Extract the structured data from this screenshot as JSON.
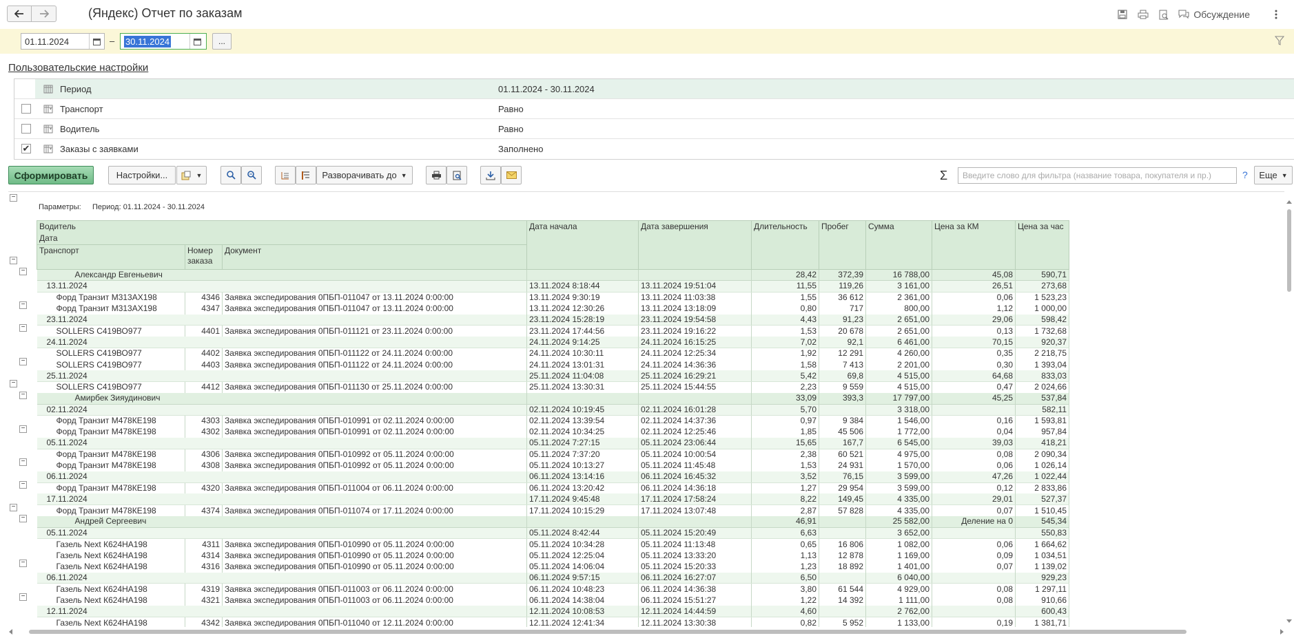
{
  "window": {
    "title": "(Яндекс) Отчет по заказам",
    "discuss_label": "Обсуждение"
  },
  "period": {
    "from": "01.11.2024",
    "to": "30.11.2024",
    "dash": "–",
    "more": "..."
  },
  "user_settings": {
    "link": "Пользовательские настройки",
    "rows": [
      {
        "name": "Период",
        "value": "01.11.2024 - 30.11.2024",
        "checked": null
      },
      {
        "name": "Транспорт",
        "value": "Равно",
        "checked": false
      },
      {
        "name": "Водитель",
        "value": "Равно",
        "checked": false
      },
      {
        "name": "Заказы с заявками",
        "value": "Заполнено",
        "checked": true
      }
    ]
  },
  "toolbar": {
    "generate": "Сформировать",
    "settings": "Настройки...",
    "expand_to": "Разворачивать до",
    "search_placeholder": "Введите слово для фильтра (название товара, покупателя и пр.)",
    "help": "?",
    "more": "Еще"
  },
  "report": {
    "params_label": "Параметры:",
    "params_value": "Период: 01.11.2024 - 30.11.2024",
    "headers": {
      "driver": "Водитель",
      "date": "Дата",
      "transport": "Транспорт",
      "order_no": "Номер заказа",
      "document": "Документ",
      "start": "Дата начала",
      "end": "Дата завершения",
      "duration": "Длительность",
      "mileage": "Пробег",
      "sum": "Сумма",
      "price_km": "Цена за КМ",
      "price_hour": "Цена за час"
    },
    "rows": [
      {
        "lvl": 1,
        "label": "Александр Евгеньевич",
        "start": "",
        "end": "",
        "dur": "28,42",
        "km": "372,39",
        "sum": "16 788,00",
        "pkm": "45,08",
        "ph": "590,71"
      },
      {
        "lvl": 2,
        "label": "13.11.2024",
        "start": "13.11.2024 8:18:44",
        "end": "13.11.2024 19:51:04",
        "dur": "11,55",
        "km": "119,26",
        "sum": "3 161,00",
        "pkm": "26,51",
        "ph": "273,68"
      },
      {
        "lvl": 3,
        "label": "Форд Транзит М313АХ198",
        "num": "4346",
        "doc": "Заявка экспедирования 0ПБП-011047 от 13.11.2024 0:00:00",
        "start": "13.11.2024 9:30:19",
        "end": "13.11.2024 11:03:38",
        "dur": "1,55",
        "km": "36 612",
        "sum": "2 361,00",
        "pkm": "0,06",
        "ph": "1 523,23"
      },
      {
        "lvl": 3,
        "label": "Форд Транзит М313АХ198",
        "num": "4347",
        "doc": "Заявка экспедирования 0ПБП-011047 от 13.11.2024 0:00:00",
        "start": "13.11.2024 12:30:26",
        "end": "13.11.2024 13:18:09",
        "dur": "0,80",
        "km": "717",
        "sum": "800,00",
        "pkm": "1,12",
        "ph": "1 000,00"
      },
      {
        "lvl": 2,
        "label": "23.11.2024",
        "start": "23.11.2024 15:28:19",
        "end": "23.11.2024 19:54:58",
        "dur": "4,43",
        "km": "91,23",
        "sum": "2 651,00",
        "pkm": "29,06",
        "ph": "598,42"
      },
      {
        "lvl": 3,
        "label": "SOLLERS С419ВО977",
        "num": "4401",
        "doc": "Заявка экспедирования 0ПБП-011121 от 23.11.2024 0:00:00",
        "start": "23.11.2024 17:44:56",
        "end": "23.11.2024 19:16:22",
        "dur": "1,53",
        "km": "20 678",
        "sum": "2 651,00",
        "pkm": "0,13",
        "ph": "1 732,68"
      },
      {
        "lvl": 2,
        "label": "24.11.2024",
        "start": "24.11.2024 9:14:25",
        "end": "24.11.2024 16:15:25",
        "dur": "7,02",
        "km": "92,1",
        "sum": "6 461,00",
        "pkm": "70,15",
        "ph": "920,37"
      },
      {
        "lvl": 3,
        "label": "SOLLERS С419ВО977",
        "num": "4402",
        "doc": "Заявка экспедирования 0ПБП-011122 от 24.11.2024 0:00:00",
        "start": "24.11.2024 10:30:11",
        "end": "24.11.2024 12:25:34",
        "dur": "1,92",
        "km": "12 291",
        "sum": "4 260,00",
        "pkm": "0,35",
        "ph": "2 218,75"
      },
      {
        "lvl": 3,
        "label": "SOLLERS С419ВО977",
        "num": "4403",
        "doc": "Заявка экспедирования 0ПБП-011122 от 24.11.2024 0:00:00",
        "start": "24.11.2024 13:01:31",
        "end": "24.11.2024 14:36:36",
        "dur": "1,58",
        "km": "7 413",
        "sum": "2 201,00",
        "pkm": "0,30",
        "ph": "1 393,04"
      },
      {
        "lvl": 2,
        "label": "25.11.2024",
        "start": "25.11.2024 11:04:08",
        "end": "25.11.2024 16:29:21",
        "dur": "5,42",
        "km": "69,8",
        "sum": "4 515,00",
        "pkm": "64,68",
        "ph": "833,03"
      },
      {
        "lvl": 3,
        "label": "SOLLERS С419ВО977",
        "num": "4412",
        "doc": "Заявка экспедирования 0ПБП-011130 от 25.11.2024 0:00:00",
        "start": "25.11.2024 13:30:31",
        "end": "25.11.2024 15:44:55",
        "dur": "2,23",
        "km": "9 559",
        "sum": "4 515,00",
        "pkm": "0,47",
        "ph": "2 024,66"
      },
      {
        "lvl": 1,
        "label": "Амирбек Зияудинович",
        "start": "",
        "end": "",
        "dur": "33,09",
        "km": "393,3",
        "sum": "17 797,00",
        "pkm": "45,25",
        "ph": "537,84"
      },
      {
        "lvl": 2,
        "label": "02.11.2024",
        "start": "02.11.2024 10:19:45",
        "end": "02.11.2024 16:01:28",
        "dur": "5,70",
        "km": "",
        "sum": "3 318,00",
        "pkm": "",
        "ph": "582,11"
      },
      {
        "lvl": 3,
        "label": "Форд Транзит М478КЕ198",
        "num": "4303",
        "doc": "Заявка экспедирования 0ПБП-010991 от 02.11.2024 0:00:00",
        "start": "02.11.2024 13:39:54",
        "end": "02.11.2024 14:37:36",
        "dur": "0,97",
        "km": "9 384",
        "sum": "1 546,00",
        "pkm": "0,16",
        "ph": "1 593,81"
      },
      {
        "lvl": 3,
        "label": "Форд Транзит М478КЕ198",
        "num": "4302",
        "doc": "Заявка экспедирования 0ПБП-010991 от 02.11.2024 0:00:00",
        "start": "02.11.2024 10:34:25",
        "end": "02.11.2024 12:25:46",
        "dur": "1,85",
        "km": "45 506",
        "sum": "1 772,00",
        "pkm": "0,04",
        "ph": "957,84"
      },
      {
        "lvl": 2,
        "label": "05.11.2024",
        "start": "05.11.2024 7:27:15",
        "end": "05.11.2024 23:06:44",
        "dur": "15,65",
        "km": "167,7",
        "sum": "6 545,00",
        "pkm": "39,03",
        "ph": "418,21"
      },
      {
        "lvl": 3,
        "label": "Форд Транзит М478КЕ198",
        "num": "4306",
        "doc": "Заявка экспедирования 0ПБП-010992 от 05.11.2024 0:00:00",
        "start": "05.11.2024 7:37:20",
        "end": "05.11.2024 10:00:54",
        "dur": "2,38",
        "km": "60 521",
        "sum": "4 975,00",
        "pkm": "0,08",
        "ph": "2 090,34"
      },
      {
        "lvl": 3,
        "label": "Форд Транзит М478КЕ198",
        "num": "4308",
        "doc": "Заявка экспедирования 0ПБП-010992 от 05.11.2024 0:00:00",
        "start": "05.11.2024 10:13:27",
        "end": "05.11.2024 11:45:48",
        "dur": "1,53",
        "km": "24 931",
        "sum": "1 570,00",
        "pkm": "0,06",
        "ph": "1 026,14"
      },
      {
        "lvl": 2,
        "label": "06.11.2024",
        "start": "06.11.2024 13:14:16",
        "end": "06.11.2024 16:45:32",
        "dur": "3,52",
        "km": "76,15",
        "sum": "3 599,00",
        "pkm": "47,26",
        "ph": "1 022,44"
      },
      {
        "lvl": 3,
        "label": "Форд Транзит М478КЕ198",
        "num": "4320",
        "doc": "Заявка экспедирования 0ПБП-011004 от 06.11.2024 0:00:00",
        "start": "06.11.2024 13:20:42",
        "end": "06.11.2024 14:36:18",
        "dur": "1,27",
        "km": "29 954",
        "sum": "3 599,00",
        "pkm": "0,12",
        "ph": "2 833,86"
      },
      {
        "lvl": 2,
        "label": "17.11.2024",
        "start": "17.11.2024 9:45:48",
        "end": "17.11.2024 17:58:24",
        "dur": "8,22",
        "km": "149,45",
        "sum": "4 335,00",
        "pkm": "29,01",
        "ph": "527,37"
      },
      {
        "lvl": 3,
        "label": "Форд Транзит М478КЕ198",
        "num": "4374",
        "doc": "Заявка экспедирования 0ПБП-011074 от 17.11.2024 0:00:00",
        "start": "17.11.2024 10:15:29",
        "end": "17.11.2024 13:07:48",
        "dur": "2,87",
        "km": "57 828",
        "sum": "4 335,00",
        "pkm": "0,07",
        "ph": "1 510,45"
      },
      {
        "lvl": 1,
        "label": "Андрей Сергеевич",
        "start": "",
        "end": "",
        "dur": "46,91",
        "km": "",
        "sum": "25 582,00",
        "pkm": "Деление на 0",
        "ph": "545,34"
      },
      {
        "lvl": 2,
        "label": "05.11.2024",
        "start": "05.11.2024 8:42:44",
        "end": "05.11.2024 15:20:49",
        "dur": "6,63",
        "km": "",
        "sum": "3 652,00",
        "pkm": "",
        "ph": "550,83"
      },
      {
        "lvl": 3,
        "label": "Газель Next К624НА198",
        "num": "4311",
        "doc": "Заявка экспедирования 0ПБП-010990 от 05.11.2024 0:00:00",
        "start": "05.11.2024 10:34:28",
        "end": "05.11.2024 11:13:48",
        "dur": "0,65",
        "km": "16 806",
        "sum": "1 082,00",
        "pkm": "0,06",
        "ph": "1 664,62"
      },
      {
        "lvl": 3,
        "label": "Газель Next К624НА198",
        "num": "4314",
        "doc": "Заявка экспедирования 0ПБП-010990 от 05.11.2024 0:00:00",
        "start": "05.11.2024 12:25:04",
        "end": "05.11.2024 13:33:20",
        "dur": "1,13",
        "km": "12 878",
        "sum": "1 169,00",
        "pkm": "0,09",
        "ph": "1 034,51"
      },
      {
        "lvl": 3,
        "label": "Газель Next К624НА198",
        "num": "4316",
        "doc": "Заявка экспедирования 0ПБП-010990 от 05.11.2024 0:00:00",
        "start": "05.11.2024 14:06:04",
        "end": "05.11.2024 15:20:33",
        "dur": "1,23",
        "km": "18 892",
        "sum": "1 401,00",
        "pkm": "0,07",
        "ph": "1 139,02"
      },
      {
        "lvl": 2,
        "label": "06.11.2024",
        "start": "06.11.2024 9:57:15",
        "end": "06.11.2024 16:27:07",
        "dur": "6,50",
        "km": "",
        "sum": "6 040,00",
        "pkm": "",
        "ph": "929,23"
      },
      {
        "lvl": 3,
        "label": "Газель Next К624НА198",
        "num": "4319",
        "doc": "Заявка экспедирования 0ПБП-011003 от 06.11.2024 0:00:00",
        "start": "06.11.2024 10:48:23",
        "end": "06.11.2024 14:36:38",
        "dur": "3,80",
        "km": "61 544",
        "sum": "4 929,00",
        "pkm": "0,08",
        "ph": "1 297,11"
      },
      {
        "lvl": 3,
        "label": "Газель Next К624НА198",
        "num": "4321",
        "doc": "Заявка экспедирования 0ПБП-011003 от 06.11.2024 0:00:00",
        "start": "06.11.2024 14:38:04",
        "end": "06.11.2024 15:51:27",
        "dur": "1,22",
        "km": "14 392",
        "sum": "1 111,00",
        "pkm": "0,08",
        "ph": "910,66"
      },
      {
        "lvl": 2,
        "label": "12.11.2024",
        "start": "12.11.2024 10:08:53",
        "end": "12.11.2024 14:44:59",
        "dur": "4,60",
        "km": "",
        "sum": "2 762,00",
        "pkm": "",
        "ph": "600,43"
      },
      {
        "lvl": 3,
        "label": "Газель Next К624НА198",
        "num": "4342",
        "doc": "Заявка экспедирования 0ПБП-011040 от 12.11.2024 0:00:00",
        "start": "12.11.2024 12:41:34",
        "end": "12.11.2024 13:30:38",
        "dur": "0,82",
        "km": "5 952",
        "sum": "1 133,00",
        "pkm": "0,19",
        "ph": "1 381,71"
      }
    ]
  }
}
